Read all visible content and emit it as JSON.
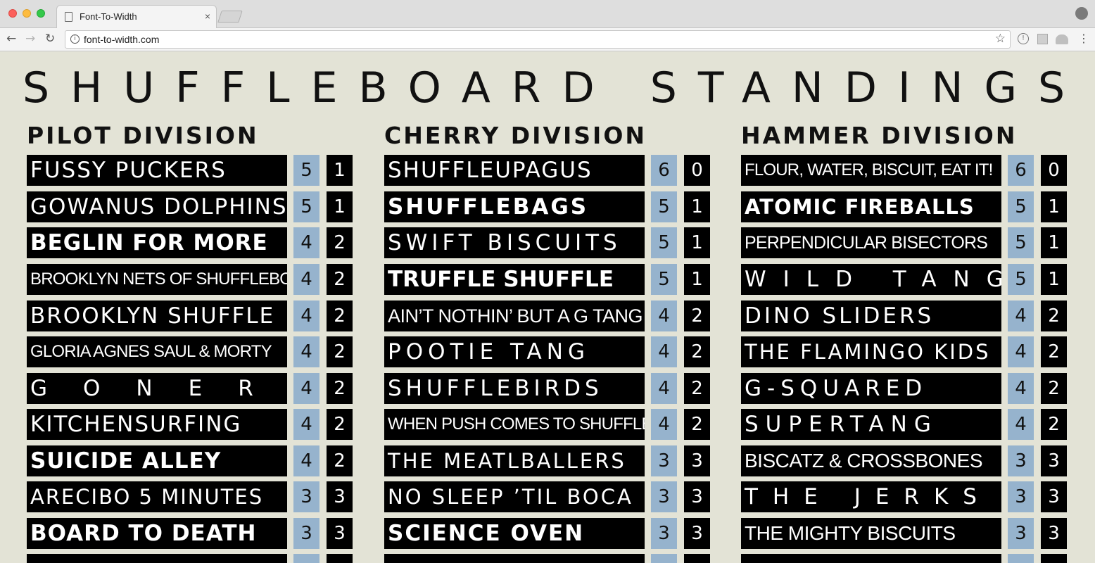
{
  "browser": {
    "tab_title": "Font-To-Width",
    "tab_close": "×",
    "url": "font-to-width.com",
    "nav_back": "←",
    "nav_forward": "→",
    "nav_reload": "↻",
    "bookmark_star": "☆",
    "info_glyph": "i",
    "menu_glyph": "⋮",
    "ext_glyph": "!"
  },
  "page": {
    "title": "SHUFFLEBOARD STANDINGS",
    "divisions": [
      {
        "name": "PILOT DIVISION",
        "teams": [
          {
            "name": "FUSSY PUCKERS",
            "wins": "5",
            "losses": "1"
          },
          {
            "name": "GOWANUS DOLPHINS",
            "wins": "5",
            "losses": "1"
          },
          {
            "name": "BEGLIN FOR MORE",
            "wins": "4",
            "losses": "2"
          },
          {
            "name": "BROOKLYN NETS OF SHUFFLEBOARD",
            "wins": "4",
            "losses": "2"
          },
          {
            "name": "BROOKLYN SHUFFLE",
            "wins": "4",
            "losses": "2"
          },
          {
            "name": "GLORIA AGNES SAUL & MORTY",
            "wins": "4",
            "losses": "2"
          },
          {
            "name": "GONER",
            "wins": "4",
            "losses": "2"
          },
          {
            "name": "KITCHENSURFING",
            "wins": "4",
            "losses": "2"
          },
          {
            "name": "SUICIDE ALLEY",
            "wins": "4",
            "losses": "2"
          },
          {
            "name": "ARECIBO 5 MINUTES",
            "wins": "3",
            "losses": "3"
          },
          {
            "name": "BOARD TO DEATH",
            "wins": "3",
            "losses": "3"
          }
        ]
      },
      {
        "name": "CHERRY DIVISION",
        "teams": [
          {
            "name": "SHUFFLEUPAGUS",
            "wins": "6",
            "losses": "0"
          },
          {
            "name": "SHUFFLEBAGS",
            "wins": "5",
            "losses": "1"
          },
          {
            "name": "SWIFT BISCUITS",
            "wins": "5",
            "losses": "1"
          },
          {
            "name": "TRUFFLE SHUFFLE",
            "wins": "5",
            "losses": "1"
          },
          {
            "name": "AIN’T NOTHIN’ BUT A G TANG",
            "wins": "4",
            "losses": "2"
          },
          {
            "name": "POOTIE TANG",
            "wins": "4",
            "losses": "2"
          },
          {
            "name": "SHUFFLEBIRDS",
            "wins": "4",
            "losses": "2"
          },
          {
            "name": "WHEN PUSH COMES TO SHUFFLE",
            "wins": "4",
            "losses": "2"
          },
          {
            "name": "THE MEATLBALLERS",
            "wins": "3",
            "losses": "3"
          },
          {
            "name": "NO SLEEP ’TIL BOCA",
            "wins": "3",
            "losses": "3"
          },
          {
            "name": "SCIENCE OVEN",
            "wins": "3",
            "losses": "3"
          }
        ]
      },
      {
        "name": "HAMMER DIVISION",
        "teams": [
          {
            "name": "FLOUR, WATER, BISCUIT, EAT IT!",
            "wins": "6",
            "losses": "0"
          },
          {
            "name": "ATOMIC FIREBALLS",
            "wins": "5",
            "losses": "1"
          },
          {
            "name": "PERPENDICULAR BISECTORS",
            "wins": "5",
            "losses": "1"
          },
          {
            "name": "WILD TANG",
            "wins": "5",
            "losses": "1"
          },
          {
            "name": "DINO SLIDERS",
            "wins": "4",
            "losses": "2"
          },
          {
            "name": "THE FLAMINGO KIDS",
            "wins": "4",
            "losses": "2"
          },
          {
            "name": "G-SQUARED",
            "wins": "4",
            "losses": "2"
          },
          {
            "name": "SUPERTANG",
            "wins": "4",
            "losses": "2"
          },
          {
            "name": "BISCATZ & CROSSBONES",
            "wins": "3",
            "losses": "3"
          },
          {
            "name": "THE JERKS",
            "wins": "3",
            "losses": "3"
          },
          {
            "name": "THE MIGHTY BISCUITS",
            "wins": "3",
            "losses": "3"
          }
        ]
      }
    ]
  },
  "colors": {
    "page_background": "#e3e3d6",
    "team_background": "#000000",
    "wins_background": "#96b3cd",
    "text": "#111111"
  }
}
